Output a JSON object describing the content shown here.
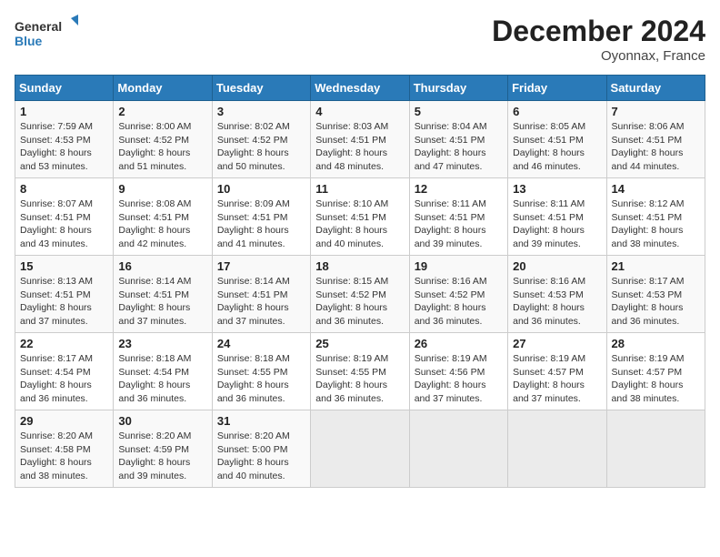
{
  "header": {
    "logo_line1": "General",
    "logo_line2": "Blue",
    "month_title": "December 2024",
    "location": "Oyonnax, France"
  },
  "days_of_week": [
    "Sunday",
    "Monday",
    "Tuesday",
    "Wednesday",
    "Thursday",
    "Friday",
    "Saturday"
  ],
  "weeks": [
    [
      {
        "day": "1",
        "lines": [
          "Sunrise: 7:59 AM",
          "Sunset: 4:53 PM",
          "Daylight: 8 hours",
          "and 53 minutes."
        ]
      },
      {
        "day": "2",
        "lines": [
          "Sunrise: 8:00 AM",
          "Sunset: 4:52 PM",
          "Daylight: 8 hours",
          "and 51 minutes."
        ]
      },
      {
        "day": "3",
        "lines": [
          "Sunrise: 8:02 AM",
          "Sunset: 4:52 PM",
          "Daylight: 8 hours",
          "and 50 minutes."
        ]
      },
      {
        "day": "4",
        "lines": [
          "Sunrise: 8:03 AM",
          "Sunset: 4:51 PM",
          "Daylight: 8 hours",
          "and 48 minutes."
        ]
      },
      {
        "day": "5",
        "lines": [
          "Sunrise: 8:04 AM",
          "Sunset: 4:51 PM",
          "Daylight: 8 hours",
          "and 47 minutes."
        ]
      },
      {
        "day": "6",
        "lines": [
          "Sunrise: 8:05 AM",
          "Sunset: 4:51 PM",
          "Daylight: 8 hours",
          "and 46 minutes."
        ]
      },
      {
        "day": "7",
        "lines": [
          "Sunrise: 8:06 AM",
          "Sunset: 4:51 PM",
          "Daylight: 8 hours",
          "and 44 minutes."
        ]
      }
    ],
    [
      {
        "day": "8",
        "lines": [
          "Sunrise: 8:07 AM",
          "Sunset: 4:51 PM",
          "Daylight: 8 hours",
          "and 43 minutes."
        ]
      },
      {
        "day": "9",
        "lines": [
          "Sunrise: 8:08 AM",
          "Sunset: 4:51 PM",
          "Daylight: 8 hours",
          "and 42 minutes."
        ]
      },
      {
        "day": "10",
        "lines": [
          "Sunrise: 8:09 AM",
          "Sunset: 4:51 PM",
          "Daylight: 8 hours",
          "and 41 minutes."
        ]
      },
      {
        "day": "11",
        "lines": [
          "Sunrise: 8:10 AM",
          "Sunset: 4:51 PM",
          "Daylight: 8 hours",
          "and 40 minutes."
        ]
      },
      {
        "day": "12",
        "lines": [
          "Sunrise: 8:11 AM",
          "Sunset: 4:51 PM",
          "Daylight: 8 hours",
          "and 39 minutes."
        ]
      },
      {
        "day": "13",
        "lines": [
          "Sunrise: 8:11 AM",
          "Sunset: 4:51 PM",
          "Daylight: 8 hours",
          "and 39 minutes."
        ]
      },
      {
        "day": "14",
        "lines": [
          "Sunrise: 8:12 AM",
          "Sunset: 4:51 PM",
          "Daylight: 8 hours",
          "and 38 minutes."
        ]
      }
    ],
    [
      {
        "day": "15",
        "lines": [
          "Sunrise: 8:13 AM",
          "Sunset: 4:51 PM",
          "Daylight: 8 hours",
          "and 37 minutes."
        ]
      },
      {
        "day": "16",
        "lines": [
          "Sunrise: 8:14 AM",
          "Sunset: 4:51 PM",
          "Daylight: 8 hours",
          "and 37 minutes."
        ]
      },
      {
        "day": "17",
        "lines": [
          "Sunrise: 8:14 AM",
          "Sunset: 4:51 PM",
          "Daylight: 8 hours",
          "and 37 minutes."
        ]
      },
      {
        "day": "18",
        "lines": [
          "Sunrise: 8:15 AM",
          "Sunset: 4:52 PM",
          "Daylight: 8 hours",
          "and 36 minutes."
        ]
      },
      {
        "day": "19",
        "lines": [
          "Sunrise: 8:16 AM",
          "Sunset: 4:52 PM",
          "Daylight: 8 hours",
          "and 36 minutes."
        ]
      },
      {
        "day": "20",
        "lines": [
          "Sunrise: 8:16 AM",
          "Sunset: 4:53 PM",
          "Daylight: 8 hours",
          "and 36 minutes."
        ]
      },
      {
        "day": "21",
        "lines": [
          "Sunrise: 8:17 AM",
          "Sunset: 4:53 PM",
          "Daylight: 8 hours",
          "and 36 minutes."
        ]
      }
    ],
    [
      {
        "day": "22",
        "lines": [
          "Sunrise: 8:17 AM",
          "Sunset: 4:54 PM",
          "Daylight: 8 hours",
          "and 36 minutes."
        ]
      },
      {
        "day": "23",
        "lines": [
          "Sunrise: 8:18 AM",
          "Sunset: 4:54 PM",
          "Daylight: 8 hours",
          "and 36 minutes."
        ]
      },
      {
        "day": "24",
        "lines": [
          "Sunrise: 8:18 AM",
          "Sunset: 4:55 PM",
          "Daylight: 8 hours",
          "and 36 minutes."
        ]
      },
      {
        "day": "25",
        "lines": [
          "Sunrise: 8:19 AM",
          "Sunset: 4:55 PM",
          "Daylight: 8 hours",
          "and 36 minutes."
        ]
      },
      {
        "day": "26",
        "lines": [
          "Sunrise: 8:19 AM",
          "Sunset: 4:56 PM",
          "Daylight: 8 hours",
          "and 37 minutes."
        ]
      },
      {
        "day": "27",
        "lines": [
          "Sunrise: 8:19 AM",
          "Sunset: 4:57 PM",
          "Daylight: 8 hours",
          "and 37 minutes."
        ]
      },
      {
        "day": "28",
        "lines": [
          "Sunrise: 8:19 AM",
          "Sunset: 4:57 PM",
          "Daylight: 8 hours",
          "and 38 minutes."
        ]
      }
    ],
    [
      {
        "day": "29",
        "lines": [
          "Sunrise: 8:20 AM",
          "Sunset: 4:58 PM",
          "Daylight: 8 hours",
          "and 38 minutes."
        ]
      },
      {
        "day": "30",
        "lines": [
          "Sunrise: 8:20 AM",
          "Sunset: 4:59 PM",
          "Daylight: 8 hours",
          "and 39 minutes."
        ]
      },
      {
        "day": "31",
        "lines": [
          "Sunrise: 8:20 AM",
          "Sunset: 5:00 PM",
          "Daylight: 8 hours",
          "and 40 minutes."
        ]
      },
      {
        "day": "",
        "lines": []
      },
      {
        "day": "",
        "lines": []
      },
      {
        "day": "",
        "lines": []
      },
      {
        "day": "",
        "lines": []
      }
    ]
  ]
}
